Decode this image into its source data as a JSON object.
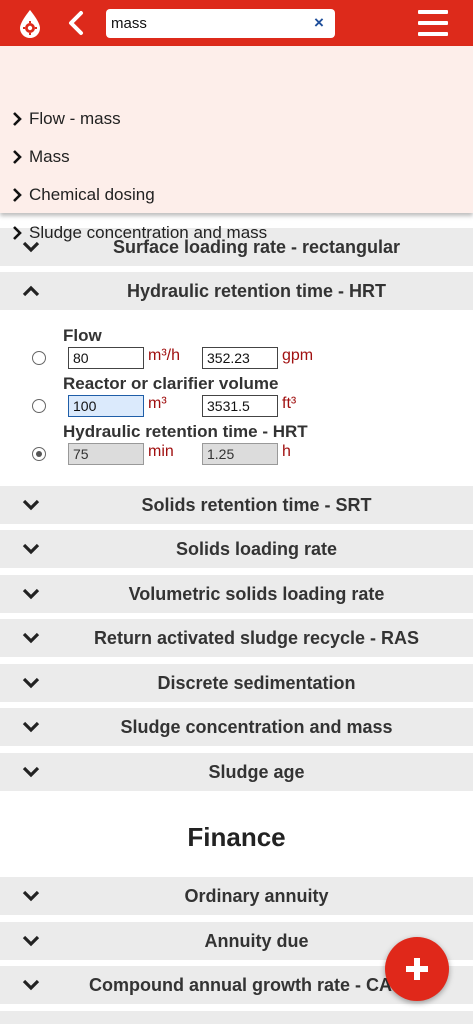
{
  "header": {
    "search_value": "mass",
    "clear_symbol": "×",
    "icons": [
      "app-logo-icon",
      "back-arrow-icon",
      "clear-icon",
      "hamburger-menu-icon"
    ],
    "accent_color": "#dd2a1b"
  },
  "suggestions": [
    {
      "label": "Flow - mass"
    },
    {
      "label": "Mass"
    },
    {
      "label": "Chemical dosing"
    },
    {
      "label": "Sludge concentration and mass"
    }
  ],
  "sections_top": [
    {
      "title": "Surface loading rate - rectangular",
      "expanded": false
    },
    {
      "title": "Hydraulic retention time - HRT",
      "expanded": true
    }
  ],
  "hrt": {
    "rows": [
      {
        "label": "Flow",
        "value_metric": "80",
        "unit_metric": "m³/h",
        "value_imperial": "352.23",
        "unit_imperial": "gpm",
        "selected": false
      },
      {
        "label": "Reactor or clarifier volume",
        "value_metric": "100",
        "unit_metric": "m³",
        "value_imperial": "3531.5",
        "unit_imperial": "ft³",
        "selected": false
      },
      {
        "label": "Hydraulic retention time - HRT",
        "value_metric": "75",
        "unit_metric": "min",
        "value_imperial": "1.25",
        "unit_imperial": "h",
        "selected": true
      }
    ]
  },
  "sections_rest": [
    {
      "title": "Solids retention time - SRT"
    },
    {
      "title": "Solids loading rate"
    },
    {
      "title": "Volumetric solids loading rate"
    },
    {
      "title": "Return activated sludge recycle - RAS"
    },
    {
      "title": "Discrete sedimentation"
    },
    {
      "title": "Sludge concentration and mass"
    },
    {
      "title": "Sludge age"
    }
  ],
  "finance": {
    "heading": "Finance",
    "sections": [
      {
        "title": "Ordinary annuity"
      },
      {
        "title": "Annuity due"
      },
      {
        "title": "Compound annual growth rate - CAGR"
      }
    ]
  },
  "fab": {
    "icon": "plus-icon"
  }
}
